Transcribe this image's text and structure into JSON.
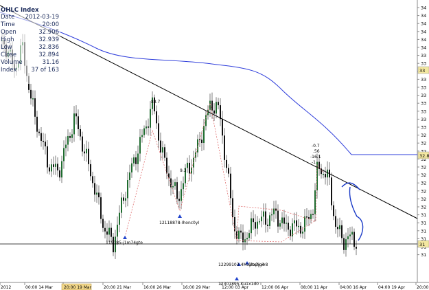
{
  "ohlc_panel": {
    "title": "OHLC Index",
    "rows": [
      {
        "label": "Date",
        "value": "2012-03-19"
      },
      {
        "label": "Time",
        "value": "20:00"
      },
      {
        "label": "Open",
        "value": "32.906"
      },
      {
        "label": "High",
        "value": "32.939"
      },
      {
        "label": "Low",
        "value": "32.836"
      },
      {
        "label": "Close",
        "value": "32.894"
      },
      {
        "label": "Volume",
        "value": "31.16"
      },
      {
        "label": "Index",
        "value": "37 of 163"
      }
    ]
  },
  "colors": {
    "background": "#ffffff",
    "candle": "#1e6b2e",
    "moving_average": "#2e3ddb",
    "trendline": "#000000",
    "zigzag": "#e07070",
    "annotation": "#1a3ac7",
    "price_tag": "#f3e7a0",
    "selected_date_tag": "#f3d88a"
  },
  "time_axis": {
    "labels": [
      {
        "text": "2012",
        "selected": false
      },
      {
        "text": "00:00 14 Mar",
        "selected": false
      },
      {
        "text": "20:00 19 Mar",
        "selected": true
      },
      {
        "text": "20:00 21 Mar",
        "selected": false
      },
      {
        "text": "16:00 26 Mar",
        "selected": false
      },
      {
        "text": "16:00 29 Mar",
        "selected": false
      },
      {
        "text": "12:00 03 Apr",
        "selected": false
      },
      {
        "text": "12:00 06 Apr",
        "selected": false
      },
      {
        "text": "08:00 11 Apr",
        "selected": false
      },
      {
        "text": "04:00 16 Apr",
        "selected": false
      },
      {
        "text": "04:00 19 Apr",
        "selected": false
      },
      {
        "text": "20:00 23 Apr",
        "selected": false
      }
    ]
  },
  "price_axis": {
    "labels": [
      "34",
      "34",
      "34",
      "34",
      "34",
      "34",
      "33",
      "33",
      "33",
      "33",
      "33",
      "33",
      "33",
      "33",
      "33",
      "33",
      "32",
      "32",
      "32",
      "32",
      "32",
      "32",
      "32",
      "32",
      "32",
      "32",
      "31",
      "31",
      "31",
      "31",
      "31",
      "31"
    ],
    "tags": [
      "33",
      "32.8",
      "31"
    ]
  },
  "chart_annotations": {
    "labels": [
      "83.7",
      "9.3",
      "-0.7",
      ".56",
      "-16.1",
      "-1",
      "12118878-Ihonc0yI",
      "119185-j1m74gte",
      "12299103-4Mxjnx3ju4",
      "1ltqhgiv8",
      "12301895-Ku1x1d0"
    ]
  },
  "chart_data": {
    "type": "candlestick",
    "title": "",
    "xlabel": "",
    "ylabel": "",
    "grid": false,
    "overlays": [
      "moving average",
      "descending trendline",
      "support line",
      "zigzag",
      "hand-drawn arrow"
    ]
  }
}
